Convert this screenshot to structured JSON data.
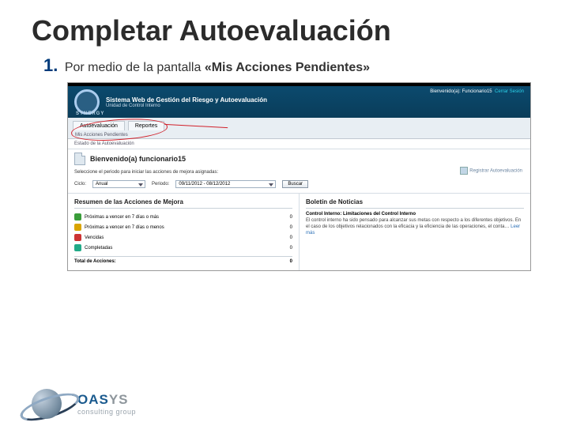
{
  "slide": {
    "title": "Completar Autoevaluación",
    "step_num": "1.",
    "step_prefix": "Por medio de la pantalla ",
    "step_emph": "«Mis Acciones Pendientes»"
  },
  "screenshot": {
    "top": {
      "system_title": "Sistema Web de Gestión del Riesgo y Autoevaluación",
      "subtitle": "Unidad de Control Interno",
      "brand": "SYNERGY",
      "welcome_user": "Bienvenido(a): Funcionario15",
      "logout": "Cerrar Sesión"
    },
    "tabs": {
      "t1": "Autoevaluación",
      "t2": "Reportes",
      "sub": "Mis Acciones Pendientes"
    },
    "subbar": "Estado de la Autoevaluación",
    "welcome": "Bienvenido(a) funcionario15",
    "instruction": "Seleccione el periodo para iniciar las acciones de mejora asignadas:",
    "register": "Registrar Autoevaluación",
    "filters": {
      "ciclo_label": "Ciclo:",
      "ciclo_value": "Anual",
      "periodo_label": "Periodo:",
      "periodo_value": "09/11/2012 - 08/12/2012",
      "buscar": "Buscar"
    },
    "left": {
      "heading": "Resumen de las Acciones de Mejora",
      "r1": "Próximas a vencer en 7 días o más",
      "r2": "Próximas a vencer en 7 días o menos",
      "r3": "Vencidas",
      "r4": "Completadas",
      "v1": "0",
      "v2": "0",
      "v3": "0",
      "v4": "0",
      "total_label": "Total de Acciones:",
      "total_value": "0"
    },
    "right": {
      "heading": "Boletín de Noticias",
      "title": "Control Interno: Limitaciones del Control Interno",
      "body": "El control interno ha sido pensado para alcanzar sus metas con respecto a los diferentes objetivos. En el caso de los objetivos relacionados con la eficacia y la eficiencia de las operaciones, el conta…",
      "link": "Leer más"
    }
  },
  "footer": {
    "brand1": "OAS",
    "brand2": "YS",
    "sub": "consulting group"
  }
}
